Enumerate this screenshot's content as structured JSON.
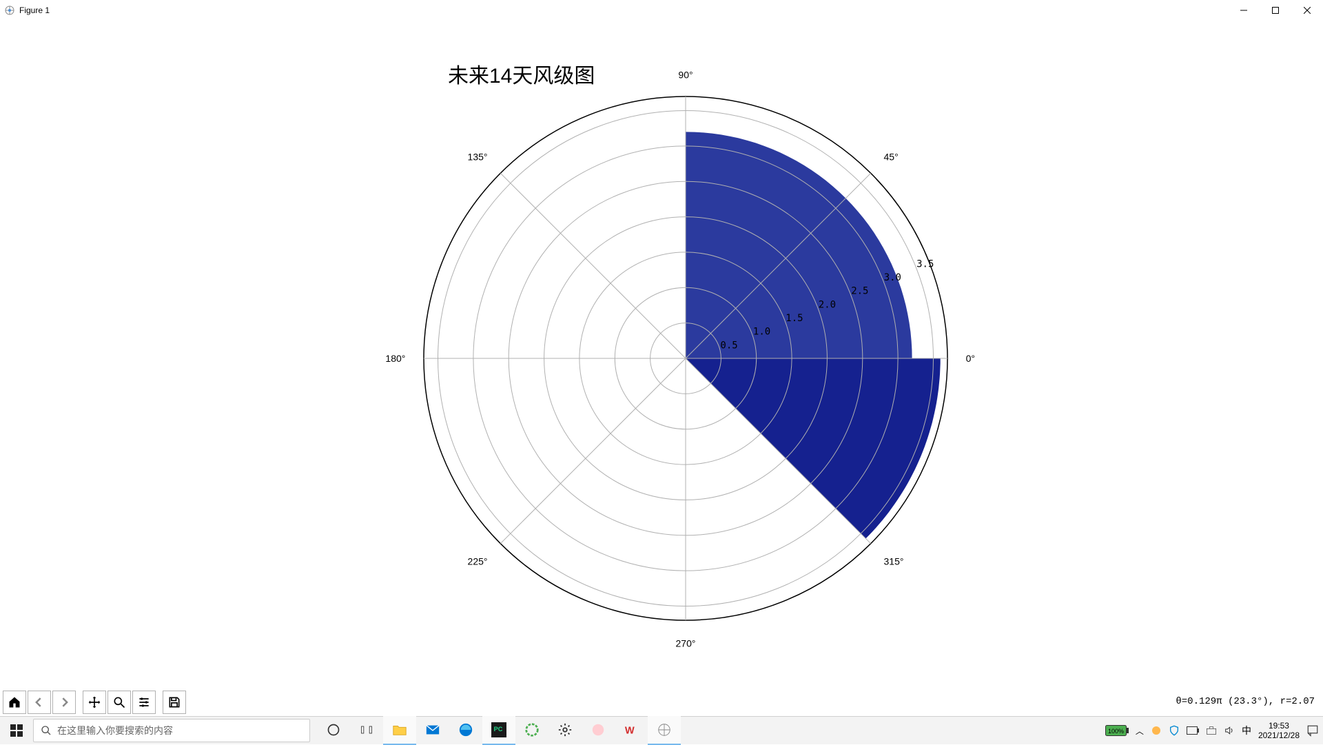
{
  "window": {
    "title": "Figure 1"
  },
  "chart_data": {
    "type": "polar-bar",
    "title": "未来14天风级图",
    "theta_ticks_deg": [
      0,
      45,
      90,
      135,
      180,
      225,
      270,
      315
    ],
    "theta_tick_labels": [
      "0°",
      "45°",
      "90°",
      "135°",
      "180°",
      "225°",
      "270°",
      "315°"
    ],
    "r_ticks": [
      0.5,
      1.0,
      1.5,
      2.0,
      2.5,
      3.0,
      3.5
    ],
    "r_tick_labels": [
      "0.5",
      "1.0",
      "1.5",
      "2.0",
      "2.5",
      "3.0",
      "3.5"
    ],
    "r_max": 3.7,
    "bars": [
      {
        "theta_start_deg": 0,
        "theta_end_deg": 90,
        "radius": 3.2,
        "color": "#2b3a9e"
      },
      {
        "theta_start_deg": 315,
        "theta_end_deg": 360,
        "radius": 3.6,
        "color": "#15218f"
      }
    ]
  },
  "statusbar": "θ=0.129π (23.3°), r=2.07",
  "mpl_toolbar": {
    "home": "Home",
    "back": "Back",
    "forward": "Forward",
    "pan": "Pan",
    "zoom": "Zoom",
    "config": "Configure subplots",
    "save": "Save"
  },
  "taskbar": {
    "search_placeholder": "在这里输入你要搜索的内容",
    "ime": "中",
    "battery": "100%",
    "time": "19:53",
    "date": "2021/12/28"
  }
}
